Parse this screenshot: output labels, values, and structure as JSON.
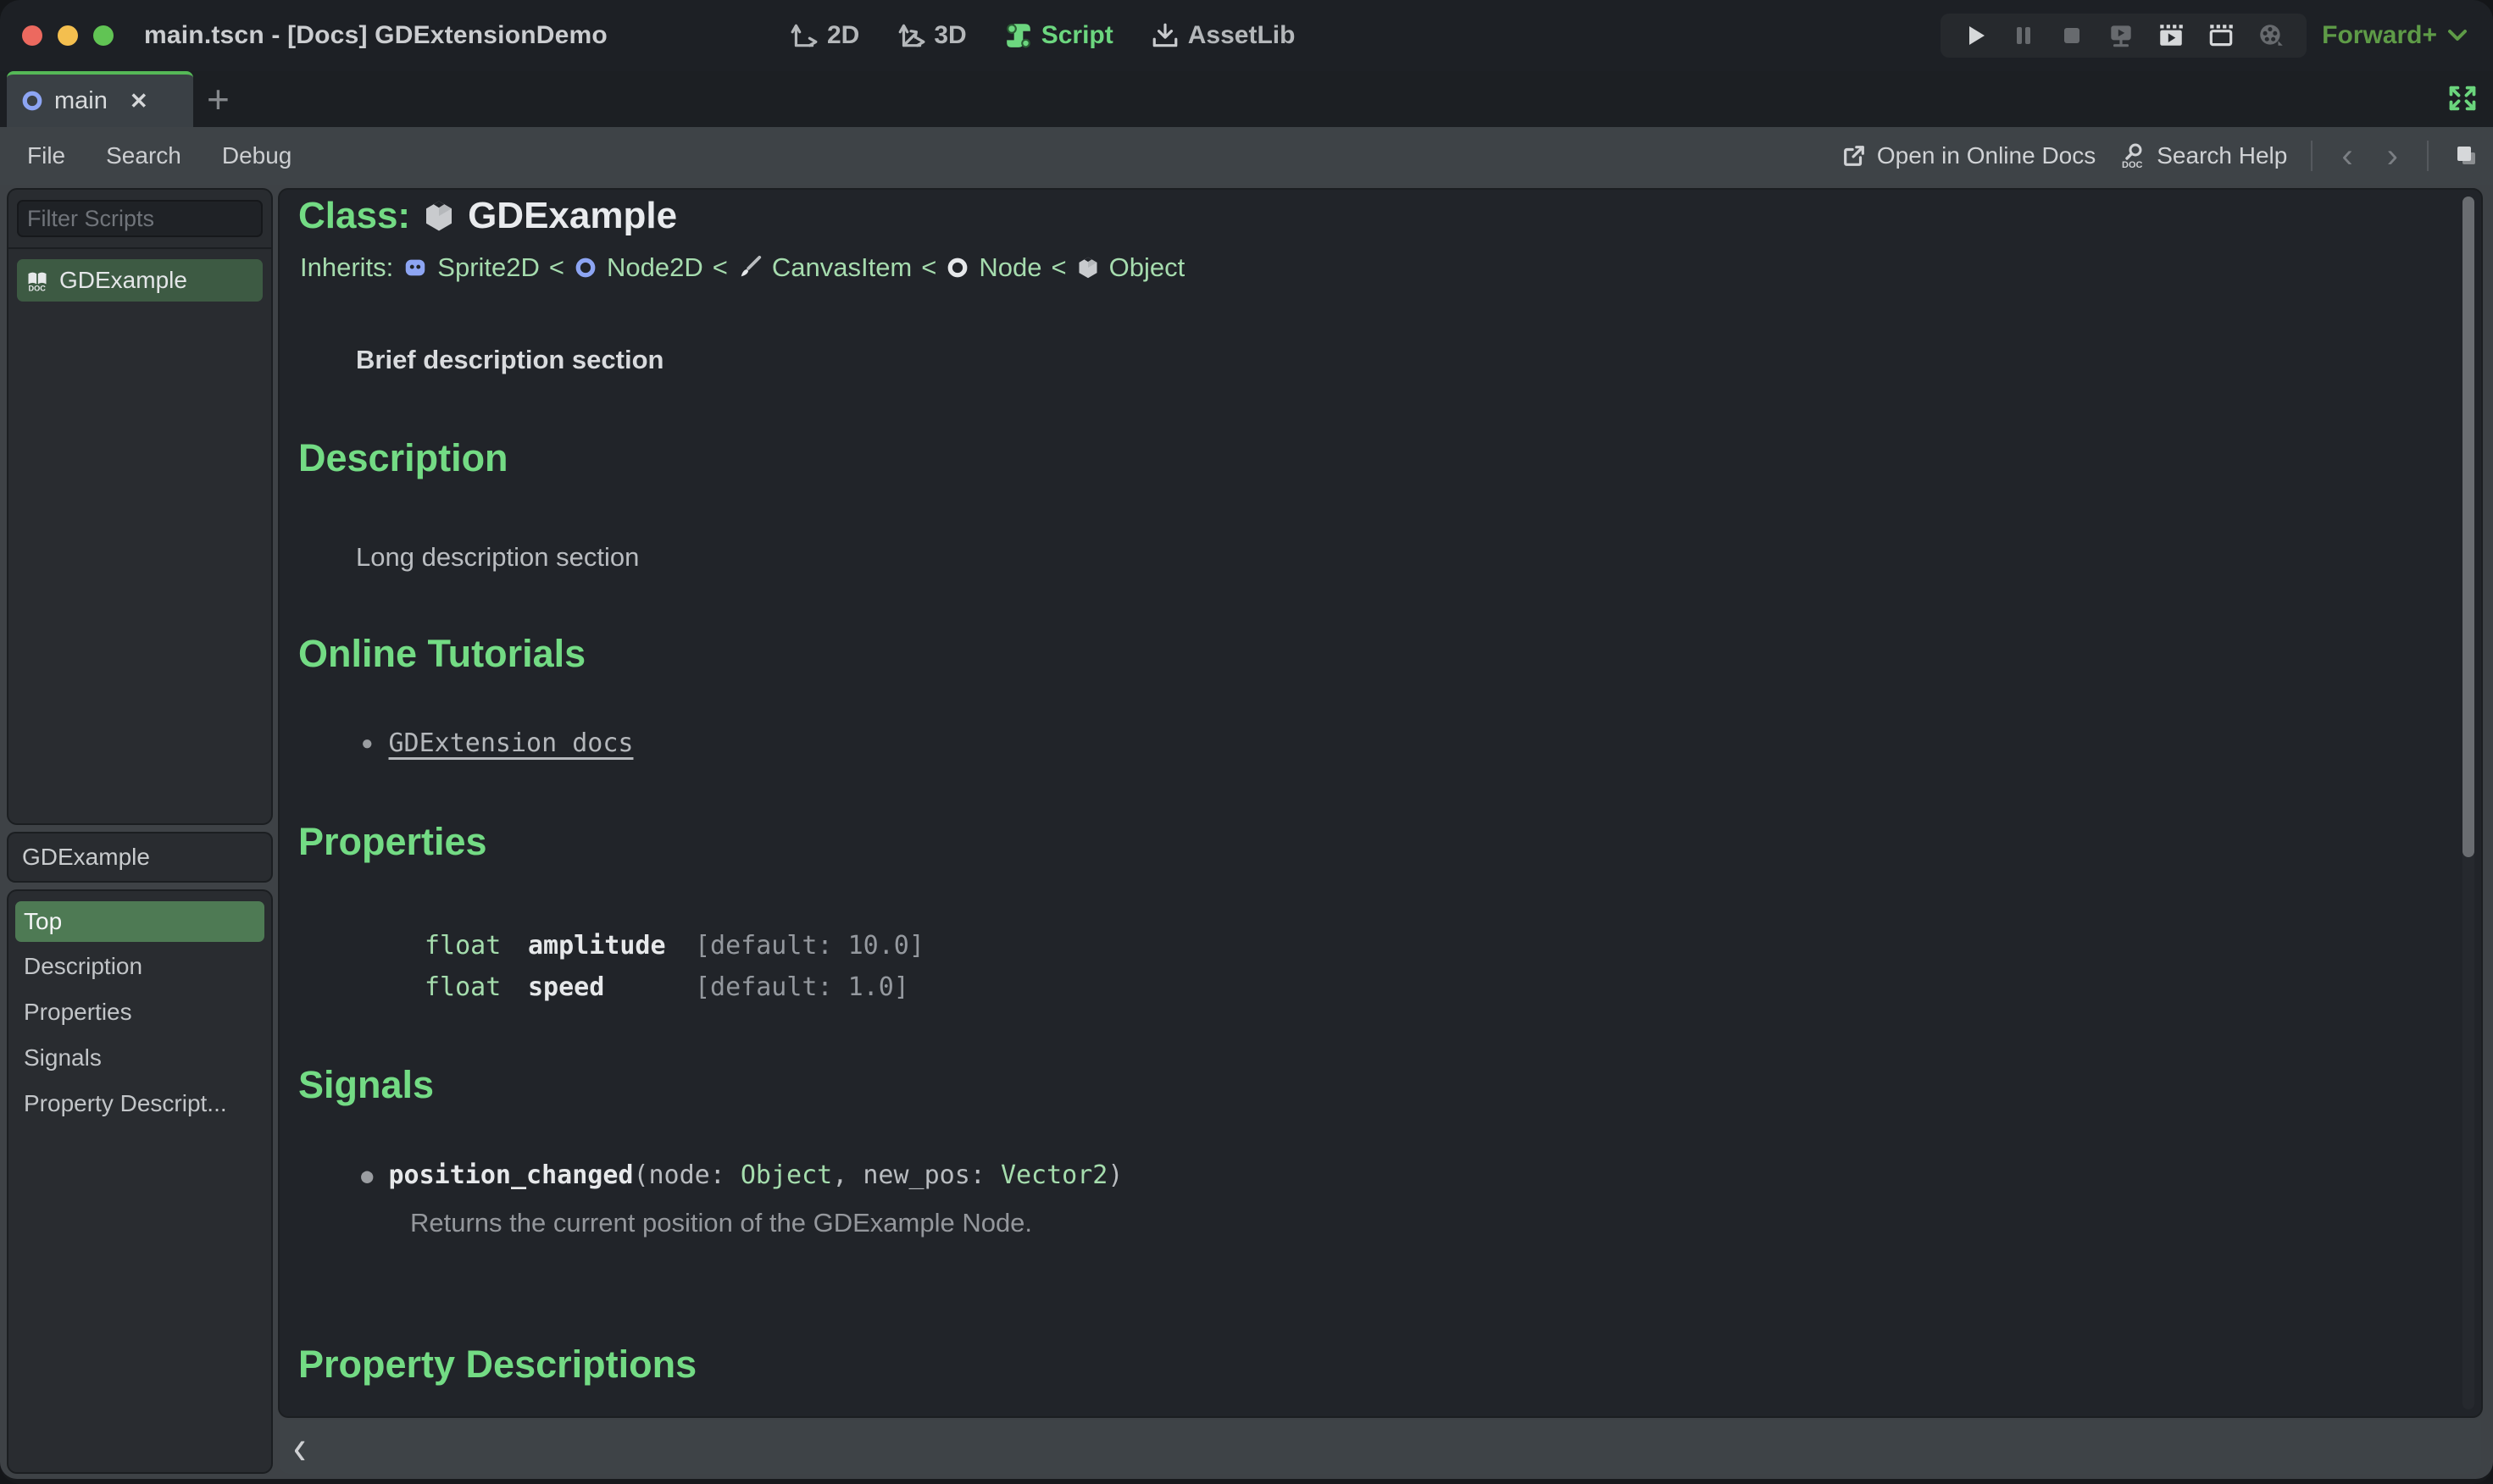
{
  "window": {
    "title": "main.tscn - [Docs] GDExtensionDemo"
  },
  "titlebar": {
    "context_buttons": [
      {
        "label": "2D"
      },
      {
        "label": "3D"
      },
      {
        "label": "Script",
        "active": true
      },
      {
        "label": "AssetLib"
      }
    ],
    "renderer": {
      "label": "Forward+"
    }
  },
  "tabs": {
    "active_label": "main",
    "close_glyph": "✕",
    "add_glyph": "+"
  },
  "menubar": {
    "items": [
      "File",
      "Search",
      "Debug"
    ],
    "open_docs_label": "Open in Online Docs",
    "search_help_label": "Search Help",
    "back_glyph": "‹",
    "forward_glyph": "›"
  },
  "scripts_panel": {
    "filter_placeholder": "Filter Scripts",
    "items": [
      {
        "label": "GDExample",
        "selected": true
      }
    ]
  },
  "sections_panel": {
    "header": "GDExample",
    "items": [
      {
        "label": "Top",
        "selected": true
      },
      {
        "label": "Description"
      },
      {
        "label": "Properties"
      },
      {
        "label": "Signals"
      },
      {
        "label": "Property Descript..."
      }
    ]
  },
  "doc": {
    "class_label": "Class:",
    "class_name": "GDExample",
    "inherits_label": "Inherits:",
    "inherits_sep": "<",
    "inherits_chain": [
      {
        "name": "Sprite2D",
        "icon": "sprite2d-icon"
      },
      {
        "name": "Node2D",
        "icon": "node2d-icon"
      },
      {
        "name": "CanvasItem",
        "icon": "canvasitem-icon"
      },
      {
        "name": "Node",
        "icon": "node-icon"
      },
      {
        "name": "Object",
        "icon": "object-icon"
      }
    ],
    "brief": "Brief description section",
    "description": {
      "heading": "Description",
      "body": "Long description section"
    },
    "tutorials": {
      "heading": "Online Tutorials",
      "bullet_glyph": "●",
      "links": [
        "GDExtension docs"
      ]
    },
    "properties": {
      "heading": "Properties",
      "rows": [
        {
          "type": "float",
          "name": "amplitude",
          "default": "[default: 10.0]"
        },
        {
          "type": "float",
          "name": "speed",
          "default": "[default: 1.0]"
        }
      ]
    },
    "signals": {
      "heading": "Signals",
      "bullet_glyph": "●",
      "items": [
        {
          "name": "position_changed",
          "open": "(node: ",
          "type1": "Object",
          "mid": ", new_pos: ",
          "type2": "Vector2",
          "close": ")",
          "desc": "Returns the current position of the GDExample Node."
        }
      ]
    },
    "property_descriptions": {
      "heading": "Property Descriptions"
    },
    "bottombar_collapse_glyph": "‹"
  },
  "colors": {
    "accent_green": "#73db84",
    "pale_green": "#a5ddad",
    "selected_green": "#4e7a54",
    "script_selected_green": "#3d5a43",
    "renderer_green": "#5e9b47",
    "node_blue": "#8da5f3",
    "traffic_red": "#ec695f",
    "traffic_yellow": "#f4bf4f",
    "traffic_green": "#61c454"
  },
  "icons": {
    "script-icon": "green scroll",
    "assetlib-icon": "download tray",
    "play-icon": "triangle",
    "expand-icon": "four green arrows",
    "search-help-icon": "magnifier over DOC book",
    "doc-book-icon": "open book DOC"
  }
}
